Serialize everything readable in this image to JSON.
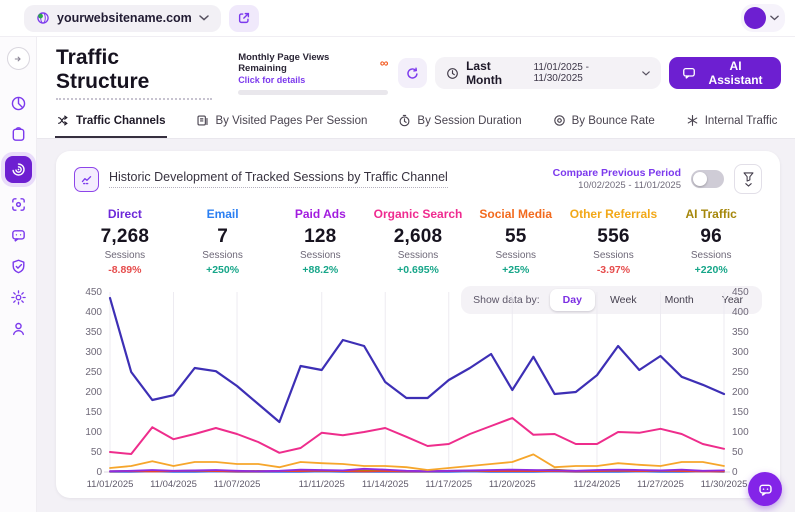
{
  "topbar": {
    "domain": "yourwebsitename.com"
  },
  "header": {
    "title": "Traffic Structure",
    "quota": {
      "title": "Monthly Page Views Remaining",
      "link": "Click for details",
      "value": "∞"
    },
    "date_filter": {
      "label": "Last Month",
      "range": "11/01/2025 - 11/30/2025"
    },
    "ai_assistant_label": "AI Assistant"
  },
  "tabs": [
    {
      "label": "Traffic Channels",
      "active": true
    },
    {
      "label": "By Visited Pages Per Session",
      "active": false
    },
    {
      "label": "By Session Duration",
      "active": false
    },
    {
      "label": "By Bounce Rate",
      "active": false
    },
    {
      "label": "Internal Traffic",
      "active": false
    }
  ],
  "card": {
    "title": "Historic Development of Tracked Sessions by Traffic Channel",
    "compare": {
      "label": "Compare Previous Period",
      "range": "10/02/2025 - 11/01/2025",
      "enabled": false
    },
    "stats": [
      {
        "label": "Direct",
        "color": "#6d28d9",
        "value": "7,268",
        "unit": "Sessions",
        "delta": "-8.89%",
        "delta_color": "#e64c4c"
      },
      {
        "label": "Email",
        "color": "#2b7ff2",
        "value": "7",
        "unit": "Sessions",
        "delta": "+250%",
        "delta_color": "#17a689"
      },
      {
        "label": "Paid Ads",
        "color": "#a21cdf",
        "value": "128",
        "unit": "Sessions",
        "delta": "+88.2%",
        "delta_color": "#17a689"
      },
      {
        "label": "Organic Search",
        "color": "#ef2b90",
        "value": "2,608",
        "unit": "Sessions",
        "delta": "+0.695%",
        "delta_color": "#17a689"
      },
      {
        "label": "Social Media",
        "color": "#f26a1e",
        "value": "55",
        "unit": "Sessions",
        "delta": "+25%",
        "delta_color": "#17a689"
      },
      {
        "label": "Other Referrals",
        "color": "#f2a818",
        "value": "556",
        "unit": "Sessions",
        "delta": "-3.97%",
        "delta_color": "#e64c4c"
      },
      {
        "label": "AI Traffic",
        "color": "#a5870b",
        "value": "96",
        "unit": "Sessions",
        "delta": "+220%",
        "delta_color": "#17a689"
      }
    ],
    "granularity": {
      "label": "Show data by:",
      "options": [
        "Day",
        "Week",
        "Month",
        "Year"
      ],
      "selected": "Day"
    }
  },
  "chart_data": {
    "type": "line",
    "title": "Historic Development of Tracked Sessions by Traffic Channel",
    "xlabel": "",
    "ylabel": "Sessions",
    "ylim": [
      0,
      450
    ],
    "ytick_step": 50,
    "y_axis_sides": [
      "left",
      "right"
    ],
    "grid": "vertical",
    "legend": "none",
    "x": [
      "11/01/2025",
      "11/02/2025",
      "11/03/2025",
      "11/04/2025",
      "11/05/2025",
      "11/06/2025",
      "11/07/2025",
      "11/08/2025",
      "11/09/2025",
      "11/10/2025",
      "11/11/2025",
      "11/12/2025",
      "11/13/2025",
      "11/14/2025",
      "11/15/2025",
      "11/16/2025",
      "11/17/2025",
      "11/18/2025",
      "11/19/2025",
      "11/20/2025",
      "11/21/2025",
      "11/22/2025",
      "11/23/2025",
      "11/24/2025",
      "11/25/2025",
      "11/26/2025",
      "11/27/2025",
      "11/28/2025",
      "11/29/2025",
      "11/30/2025"
    ],
    "tick_labels": [
      "11/01/2025",
      "11/04/2025",
      "11/07/2025",
      "11/11/2025",
      "11/14/2025",
      "11/17/2025",
      "11/20/2025",
      "11/24/2025",
      "11/27/2025",
      "11/30/2025"
    ],
    "tick_day_indices": [
      0,
      3,
      6,
      10,
      13,
      16,
      19,
      23,
      26,
      29
    ],
    "series": [
      {
        "name": "Email",
        "color": "#2b6bf0",
        "width": 1.6,
        "values": [
          0,
          0,
          1,
          0,
          0,
          1,
          0,
          0,
          0,
          0,
          1,
          0,
          0,
          0,
          0,
          0,
          0,
          1,
          0,
          0,
          0,
          1,
          0,
          0,
          0,
          1,
          0,
          0,
          1,
          0
        ]
      },
      {
        "name": "AI Traffic",
        "color": "#a5870b",
        "width": 1.6,
        "values": [
          2,
          3,
          2,
          3,
          4,
          3,
          2,
          3,
          2,
          4,
          3,
          3,
          4,
          3,
          3,
          2,
          3,
          4,
          3,
          5,
          4,
          6,
          3,
          3,
          4,
          3,
          4,
          4,
          3,
          3
        ]
      },
      {
        "name": "Social Media",
        "color": "#e8452c",
        "width": 1.6,
        "values": [
          1,
          2,
          1,
          2,
          3,
          2,
          1,
          1,
          2,
          2,
          3,
          2,
          1,
          2,
          1,
          1,
          2,
          3,
          2,
          2,
          2,
          2,
          1,
          2,
          3,
          2,
          3,
          2,
          1,
          1
        ]
      },
      {
        "name": "Paid Ads",
        "color": "#8f2be0",
        "width": 1.8,
        "values": [
          2,
          3,
          5,
          3,
          4,
          5,
          3,
          2,
          3,
          6,
          5,
          4,
          8,
          6,
          3,
          2,
          3,
          4,
          5,
          6,
          5,
          4,
          3,
          5,
          6,
          5,
          4,
          6,
          3,
          4
        ]
      },
      {
        "name": "Other Referrals",
        "color": "#f6a62b",
        "width": 1.8,
        "values": [
          10,
          15,
          27,
          15,
          25,
          25,
          20,
          20,
          12,
          25,
          22,
          20,
          15,
          15,
          12,
          5,
          10,
          15,
          20,
          25,
          44,
          12,
          15,
          15,
          22,
          18,
          15,
          25,
          25,
          15
        ]
      },
      {
        "name": "Organic Search",
        "color": "#ee2d8c",
        "width": 2,
        "values": [
          50,
          45,
          112,
          82,
          95,
          110,
          95,
          75,
          48,
          60,
          98,
          92,
          100,
          110,
          88,
          65,
          70,
          95,
          115,
          135,
          93,
          95,
          70,
          70,
          100,
          98,
          108,
          95,
          70,
          58
        ]
      },
      {
        "name": "Direct",
        "color": "#3d2fb5",
        "width": 2.2,
        "values": [
          435,
          250,
          180,
          192,
          260,
          252,
          215,
          170,
          125,
          265,
          255,
          330,
          315,
          225,
          185,
          185,
          230,
          260,
          295,
          205,
          288,
          195,
          200,
          242,
          315,
          255,
          290,
          238,
          218,
          195
        ]
      }
    ]
  },
  "colors": {
    "accent": "#6d1fd1",
    "positive": "#17a689",
    "negative": "#e64c4c"
  },
  "icons": {
    "infinity": "∞"
  }
}
